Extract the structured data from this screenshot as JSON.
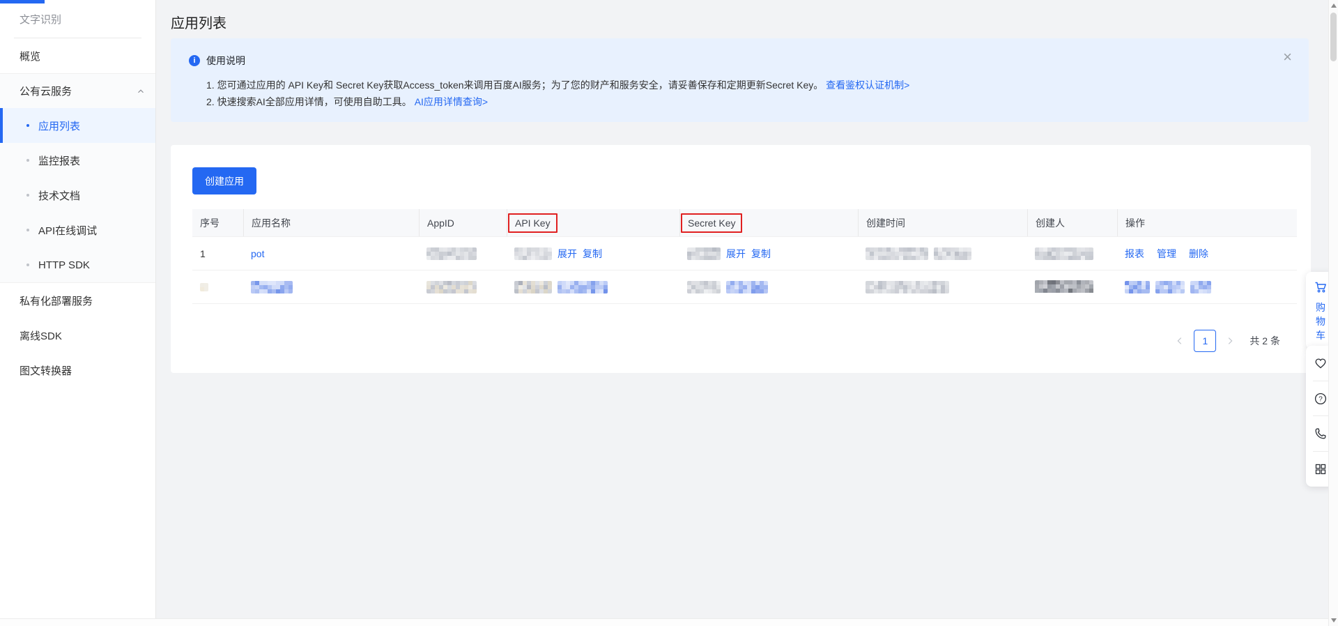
{
  "colors": {
    "accent": "#2468f2",
    "banner_bg": "#e8f1fe",
    "annotation_red": "#e02020"
  },
  "sidebar": {
    "title": "文字识别",
    "overview": "概览",
    "group_label": "公有云服务",
    "group_items": [
      {
        "label": "应用列表"
      },
      {
        "label": "监控报表"
      },
      {
        "label": "技术文档"
      },
      {
        "label": "API在线调试"
      },
      {
        "label": "HTTP SDK"
      }
    ],
    "bottom_items": [
      {
        "label": "私有化部署服务"
      },
      {
        "label": "离线SDK"
      },
      {
        "label": "图文转换器"
      }
    ]
  },
  "page": {
    "title": "应用列表"
  },
  "banner": {
    "title": "使用说明",
    "line1": "1. 您可通过应用的 API Key和 Secret Key获取Access_token来调用百度AI服务；为了您的财产和服务安全，请妥善保存和定期更新Secret Key。",
    "line1_link": "查看鉴权认证机制>",
    "line2": "2. 快速搜索AI全部应用详情，可使用自助工具。",
    "line2_link": "AI应用详情查询>",
    "close_glyph": "×"
  },
  "toolbar": {
    "create_button": "创建应用"
  },
  "table": {
    "headers": [
      "序号",
      "应用名称",
      "AppID",
      "API Key",
      "Secret Key",
      "创建时间",
      "创建人",
      "操作"
    ],
    "labels": {
      "expand": "展开",
      "copy": "复制"
    },
    "rows": [
      {
        "no": "1",
        "name": "pot",
        "actions": [
          "报表",
          "管理",
          "删除"
        ]
      }
    ]
  },
  "pagination": {
    "current": "1",
    "total_label": "共 2 条"
  },
  "float_panel": {
    "cart_label": "购物车"
  }
}
